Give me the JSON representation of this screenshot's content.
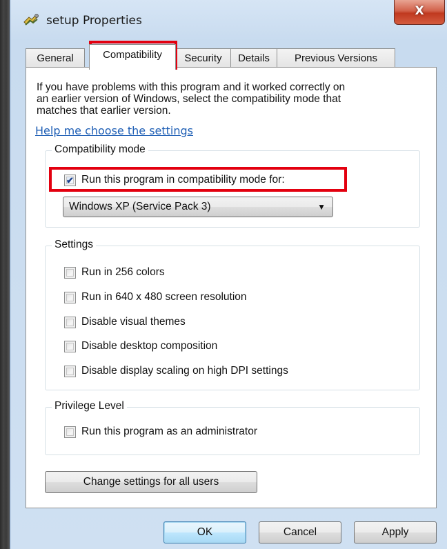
{
  "window": {
    "title": "setup Properties",
    "close_label": "X"
  },
  "tabs": [
    {
      "label": "General",
      "active": false
    },
    {
      "label": "Compatibility",
      "active": true
    },
    {
      "label": "Security",
      "active": false
    },
    {
      "label": "Details",
      "active": false
    },
    {
      "label": "Previous Versions",
      "active": false
    }
  ],
  "compat": {
    "intro_line1": "If you have problems with this program and it worked correctly on",
    "intro_line2": "an earlier version of Windows, select the compatibility mode that",
    "intro_line3": "matches that earlier version.",
    "help_link": "Help me choose the settings",
    "mode_group": {
      "legend": "Compatibility mode",
      "run_in_mode_label": "Run this program in compatibility mode for:",
      "run_in_mode_checked": true,
      "selected_os": "Windows XP (Service Pack 3)"
    },
    "settings_group": {
      "legend": "Settings",
      "items": [
        {
          "label": "Run in 256 colors",
          "checked": false
        },
        {
          "label": "Run in 640 x 480 screen resolution",
          "checked": false
        },
        {
          "label": "Disable visual themes",
          "checked": false
        },
        {
          "label": "Disable desktop composition",
          "checked": false
        },
        {
          "label": "Disable display scaling on high DPI settings",
          "checked": false
        }
      ]
    },
    "privilege_group": {
      "legend": "Privilege Level",
      "admin_label": "Run this program as an administrator",
      "admin_checked": false
    },
    "change_all_users_label": "Change settings for all users"
  },
  "footer": {
    "ok_label": "OK",
    "cancel_label": "Cancel",
    "apply_label": "Apply"
  },
  "colors": {
    "highlight": "#e3000f",
    "link": "#1f5fb5",
    "close_button": "#c0391f"
  },
  "icons": {
    "app": "setup-program-icon",
    "dropdown": "chevron-down-icon",
    "check": "check-icon"
  }
}
